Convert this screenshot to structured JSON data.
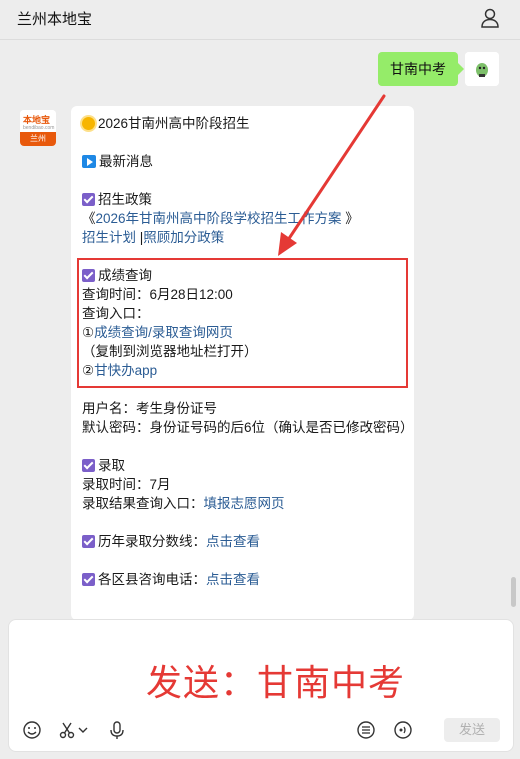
{
  "header": {
    "title": "兰州本地宝",
    "user_icon": "user-icon"
  },
  "sent_message": {
    "text": "甘南中考",
    "avatar_icon": "sticker-avatar-icon"
  },
  "received": {
    "avatar": {
      "brand": "本地宝",
      "brand_sub": "bendibao.com",
      "city": "兰州"
    },
    "title": "2026甘南州高中阶段招生",
    "latest": "最新消息",
    "policy_heading": "招生政策",
    "policy_link_prefix": "《",
    "policy_link": "2026年甘南州高中阶段学校招生工作方案",
    "policy_link_suffix": " 》",
    "plan_link": "招生计划",
    "sep": " |",
    "bonus_link": "照顾加分政策",
    "score_heading": "成绩查询",
    "score_time": "查询时间：6月28日12:00",
    "score_entry": "查询入口：",
    "entry1_num": "①",
    "entry1_link": "成绩查询/录取查询网页",
    "entry1_note": "（复制到浏览器地址栏打开）",
    "entry2_num": "②",
    "entry2_link": "甘快办app",
    "username": "用户名：考生身份证号",
    "password": "默认密码：身份证号码的后6位（确认是否已修改密码）",
    "admit_heading": "录取",
    "admit_time": "录取时间：7月",
    "admit_entry_prefix": "录取结果查询入口：",
    "admit_entry_link": "填报志愿网页",
    "history_prefix": "历年录取分数线：",
    "history_link": "点击查看",
    "phone_prefix": "各区县咨询电话：",
    "phone_link": "点击查看"
  },
  "input": {
    "text": "发送：甘南中考",
    "send_label": "发送",
    "tools": [
      "emoji-icon",
      "scissors-icon",
      "chevron-down-icon",
      "microphone-icon",
      "history-icon",
      "voice-call-icon"
    ]
  },
  "colors": {
    "bubble_sent": "#95ec69",
    "link": "#2b5c94",
    "highlight": "#e53935",
    "checkbox": "#7b5fc9"
  }
}
